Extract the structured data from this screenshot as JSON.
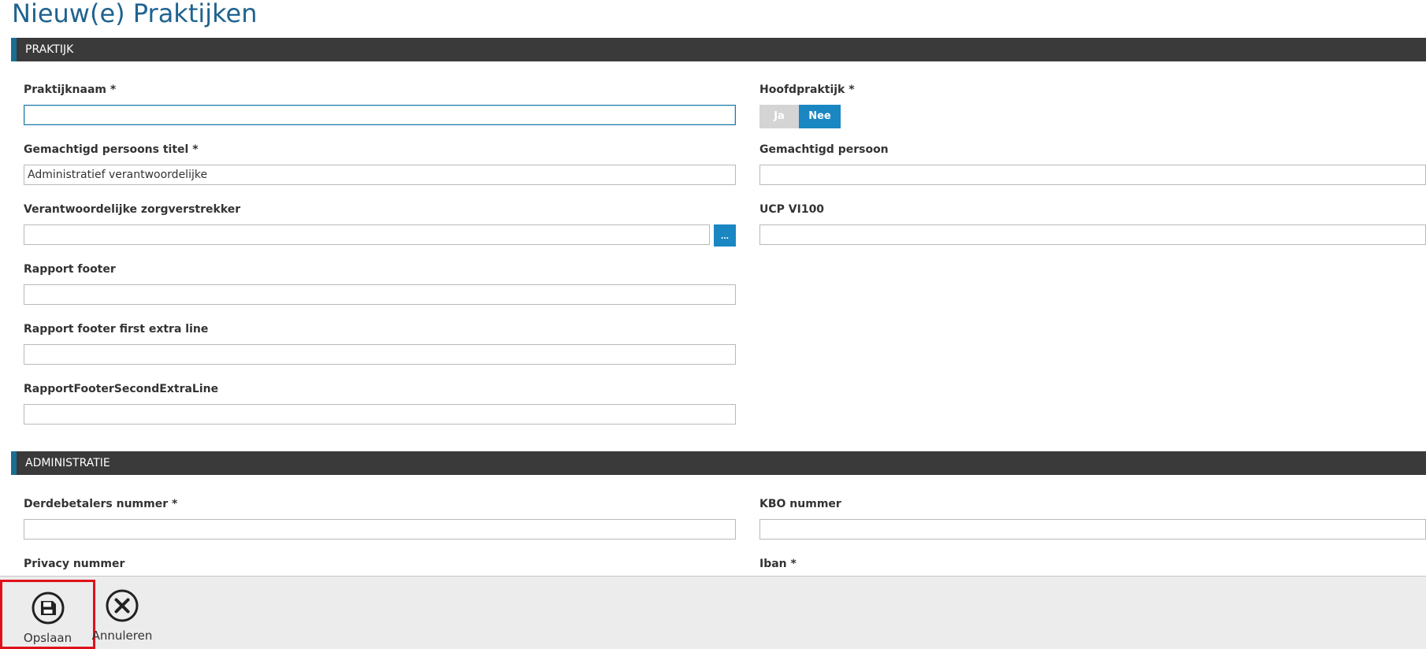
{
  "page": {
    "title": "Nieuw(e) Praktijken"
  },
  "sections": {
    "praktijk": "PRAKTIJK",
    "administratie": "ADMINISTRATIE"
  },
  "fields": {
    "praktijknaam": {
      "label": "Praktijknaam *",
      "value": ""
    },
    "hoofdpraktijk": {
      "label": "Hoofdpraktijk *",
      "options": [
        "Ja",
        "Nee"
      ],
      "selected": "Nee"
    },
    "gemachtigd_persoons_titel": {
      "label": "Gemachtigd persoons titel *",
      "value": "Administratief verantwoordelijke"
    },
    "gemachtigd_persoon": {
      "label": "Gemachtigd persoon",
      "value": ""
    },
    "verantwoordelijke_zorgverstrekker": {
      "label": "Verantwoordelijke zorgverstrekker",
      "value": "",
      "lookup_label": "..."
    },
    "ucp_vi100": {
      "label": "UCP VI100",
      "value": ""
    },
    "rapport_footer": {
      "label": "Rapport footer",
      "value": ""
    },
    "rapport_footer_first_extra_line": {
      "label": "Rapport footer first extra line",
      "value": ""
    },
    "rapport_footer_second_extra_line": {
      "label": "RapportFooterSecondExtraLine",
      "value": ""
    },
    "derdebetalers_nummer": {
      "label": "Derdebetalers nummer *",
      "value": ""
    },
    "kbo_nummer": {
      "label": "KBO nummer",
      "value": ""
    },
    "privacy_nummer": {
      "label": "Privacy nummer"
    },
    "iban": {
      "label": "Iban *"
    }
  },
  "toolbar": {
    "save": {
      "label": "Opslaan",
      "icon": "floppy-disk-icon"
    },
    "cancel": {
      "label": "Annuleren",
      "icon": "close-circle-icon"
    }
  },
  "colors": {
    "title": "#1f6390",
    "section_bg": "#3a3a3a",
    "section_accent": "#1a6e94",
    "primary": "#1a87c3",
    "highlight": "#e0101a"
  }
}
